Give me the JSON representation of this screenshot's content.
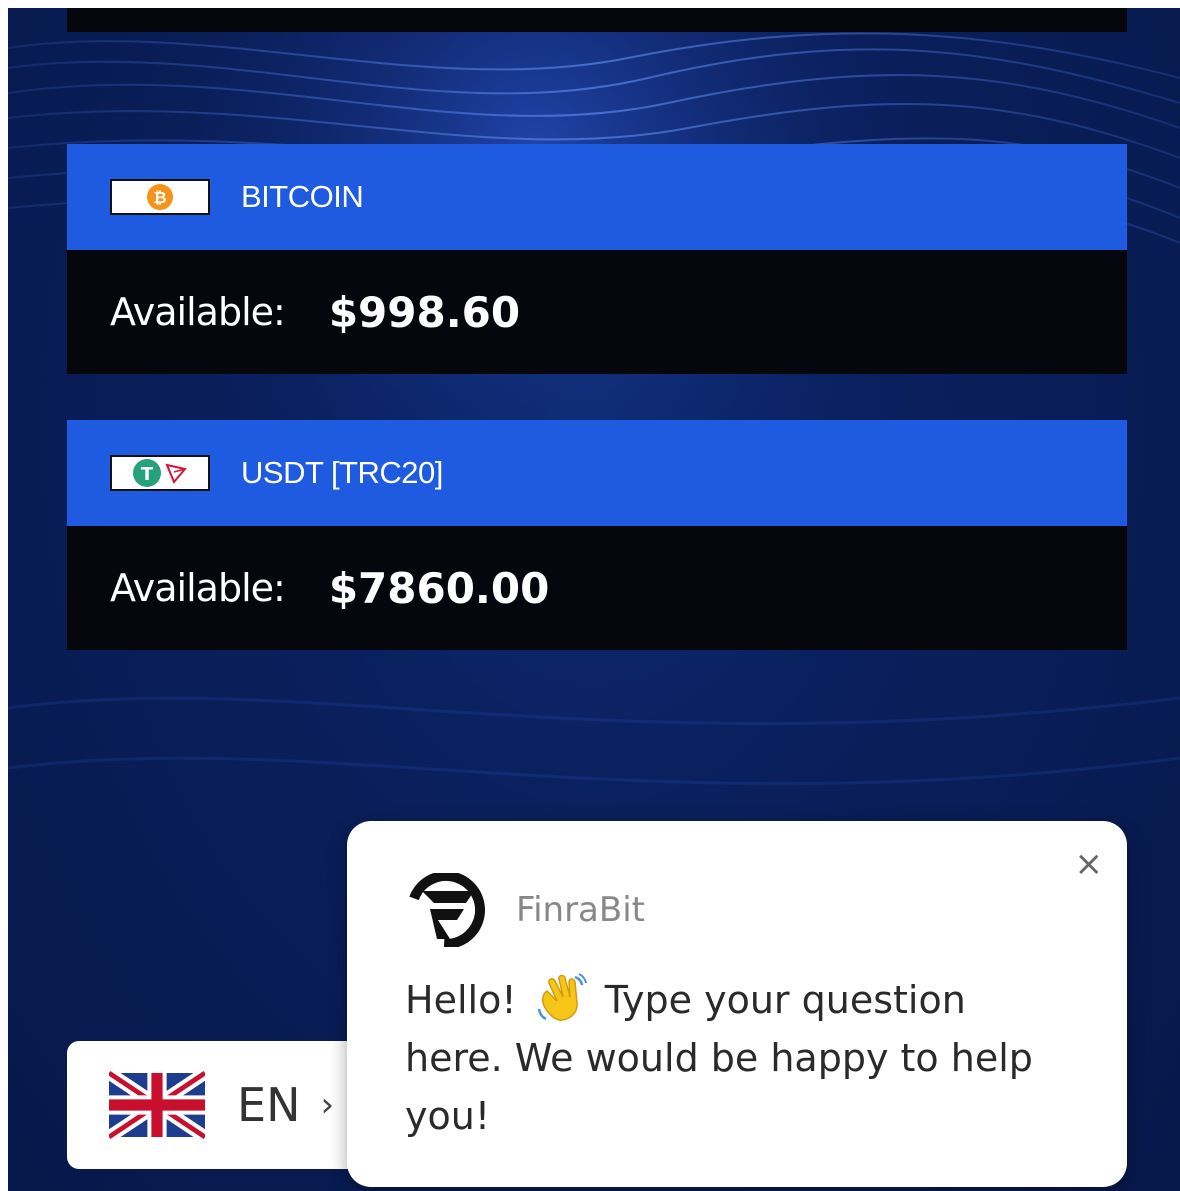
{
  "wallets": [
    {
      "name": "BITCOIN",
      "icon": "bitcoin-icon",
      "available_label": "Available:",
      "available_value": "$998.60"
    },
    {
      "name": "USDT [TRC20]",
      "icon": "tether-tron-icon",
      "available_label": "Available:",
      "available_value": "$7860.00"
    }
  ],
  "language": {
    "code": "EN",
    "flag": "uk-flag-icon",
    "chevron": "›"
  },
  "chat": {
    "brand": "FinraBit",
    "close": "×",
    "message_part1": "Hello!",
    "message_part2": "Type your question here. We would be happy to help you!"
  },
  "colors": {
    "background": "#0a1f5c",
    "header_blue": "#1f5be0",
    "card_black": "#05070d",
    "bitcoin_orange": "#f7931a",
    "tether_green": "#26a17b",
    "tron_red": "#d4143c"
  }
}
